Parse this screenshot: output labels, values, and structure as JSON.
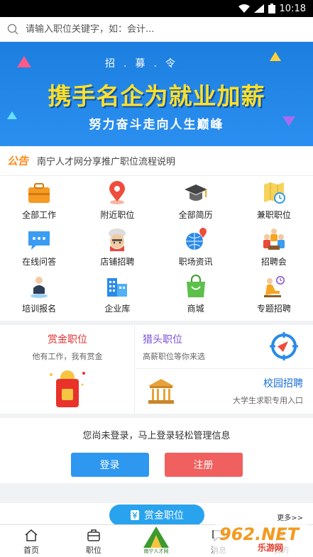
{
  "status": {
    "time": "10:18"
  },
  "search": {
    "placeholder": "请输入职位关键字，如：会计..."
  },
  "banner": {
    "tag": "招.募.令",
    "headline": "携手名企为就业加薪",
    "subline": "努力奋斗走向人生巅峰"
  },
  "notice": {
    "logo": "公告",
    "text": "南宁人才网分享推广职位流程说明"
  },
  "grid": {
    "items": [
      {
        "label": "全部工作",
        "icon": "briefcase-icon"
      },
      {
        "label": "附近职位",
        "icon": "location-pin-icon"
      },
      {
        "label": "全部简历",
        "icon": "graduation-cap-icon"
      },
      {
        "label": "兼职职位",
        "icon": "map-clock-icon"
      },
      {
        "label": "在线问答",
        "icon": "chat-bubble-icon"
      },
      {
        "label": "店铺招聘",
        "icon": "chef-icon"
      },
      {
        "label": "职场资讯",
        "icon": "globe-pin-icon"
      },
      {
        "label": "招聘会",
        "icon": "people-meeting-icon"
      },
      {
        "label": "培训报名",
        "icon": "person-training-icon"
      },
      {
        "label": "企业库",
        "icon": "buildings-icon"
      },
      {
        "label": "商城",
        "icon": "shopping-bag-icon"
      },
      {
        "label": "专题招聘",
        "icon": "person-clock-icon"
      }
    ]
  },
  "promo": {
    "bounty": {
      "title": "赏金职位",
      "desc": "他有工作，我有赏金"
    },
    "headhunter": {
      "title": "猎头职位",
      "desc": "高薪职位等你来选"
    },
    "campus": {
      "title": "校园招聘",
      "desc": "大学生求职专用入口"
    }
  },
  "login": {
    "message": "您尚未登录，马上登录轻松管理信息",
    "login_label": "登录",
    "register_label": "注册"
  },
  "section": {
    "pill_label": "赏金职位",
    "more_label": "更多>>"
  },
  "tabbar": {
    "items": [
      {
        "label": "首页"
      },
      {
        "label": "职位"
      },
      {
        "label": "南宁人才网"
      },
      {
        "label": "消息"
      },
      {
        "label": "我的"
      }
    ]
  },
  "watermark": {
    "brand": "962.NET",
    "sub": "乐游网"
  },
  "colors": {
    "banner": "#1c7fe0",
    "accent_blue": "#2e97ef",
    "accent_red": "#f0605f",
    "bounty_red": "#e03131"
  }
}
